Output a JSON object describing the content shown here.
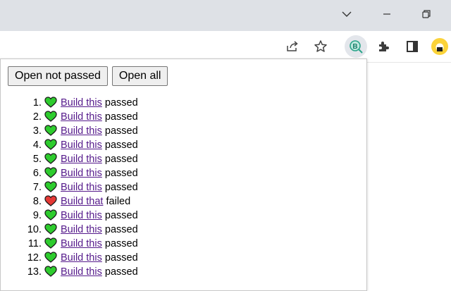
{
  "colors": {
    "passed": "#2ecc2e",
    "failed": "#e53935",
    "link": "#551a8b",
    "extension_badge": "#fbd33a"
  },
  "window_controls": [
    "chevron-down-icon",
    "minimize-icon",
    "restore-icon"
  ],
  "toolbar_icons": [
    "share-icon",
    "star-icon",
    "extension-b-icon",
    "puzzle-icon",
    "side-panel-icon",
    "profile-icon"
  ],
  "popup": {
    "open_not_passed_label": "Open not passed",
    "open_all_label": "Open all",
    "results": [
      {
        "num": "1.",
        "link": "Build this",
        "status": "passed"
      },
      {
        "num": "2.",
        "link": "Build this",
        "status": "passed"
      },
      {
        "num": "3.",
        "link": "Build this",
        "status": "passed"
      },
      {
        "num": "4.",
        "link": "Build this",
        "status": "passed"
      },
      {
        "num": "5.",
        "link": "Build this",
        "status": "passed"
      },
      {
        "num": "6.",
        "link": "Build this",
        "status": "passed"
      },
      {
        "num": "7.",
        "link": "Build this",
        "status": "passed"
      },
      {
        "num": "8.",
        "link": "Build that",
        "status": "failed"
      },
      {
        "num": "9.",
        "link": "Build this",
        "status": "passed"
      },
      {
        "num": "10.",
        "link": "Build this",
        "status": "passed"
      },
      {
        "num": "11.",
        "link": "Build this",
        "status": "passed"
      },
      {
        "num": "12.",
        "link": "Build this",
        "status": "passed"
      },
      {
        "num": "13.",
        "link": "Build this",
        "status": "passed"
      }
    ]
  }
}
